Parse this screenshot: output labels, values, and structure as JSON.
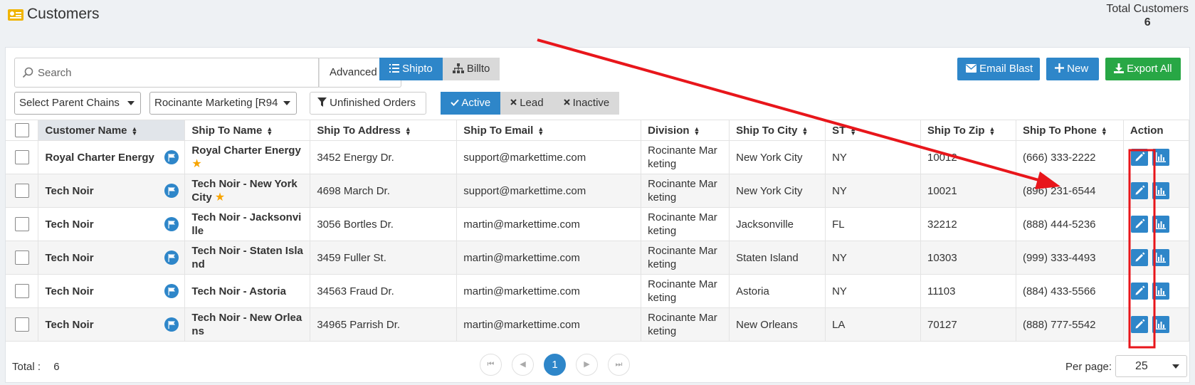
{
  "header": {
    "title": "Customers",
    "icon": "contact-card-icon",
    "total_label": "Total Customers",
    "total_value": "6"
  },
  "toolbar": {
    "search_placeholder": "Search",
    "advanced_label": "Advanced",
    "view_toggle": [
      {
        "label": "Shipto",
        "active": true,
        "icon": "list-icon"
      },
      {
        "label": "Billto",
        "active": false,
        "icon": "sitemap-icon"
      }
    ],
    "email_blast_label": "Email Blast",
    "new_label": "New",
    "export_all_label": "Export All"
  },
  "filters": {
    "parent_chains": "Select Parent Chains",
    "company": "Rocinante Marketing [R94",
    "unfinished_orders": "Unfinished Orders",
    "status": [
      {
        "label": "Active",
        "active": true,
        "icon": "check-icon"
      },
      {
        "label": "Lead",
        "active": false,
        "icon": "x-icon"
      },
      {
        "label": "Inactive",
        "active": false,
        "icon": "x-icon"
      }
    ]
  },
  "table": {
    "columns": [
      "Customer Name",
      "Ship To Name",
      "Ship To Address",
      "Ship To Email",
      "Division",
      "Ship To City",
      "ST",
      "Ship To Zip",
      "Ship To Phone",
      "Action"
    ],
    "rows": [
      {
        "customer": "Royal Charter Energy",
        "shipto_name": "Royal Charter Energy",
        "starred": true,
        "address": "3452 Energy Dr.",
        "email": "support@markettime.com",
        "division": "Rocinante Marketing",
        "city": "New York City",
        "st": "NY",
        "zip": "10012",
        "phone": "(666) 333-2222"
      },
      {
        "customer": "Tech Noir",
        "shipto_name": "Tech Noir - New York City",
        "starred": true,
        "address": "4698 March Dr.",
        "email": "support@markettime.com",
        "division": "Rocinante Marketing",
        "city": "New York City",
        "st": "NY",
        "zip": "10021",
        "phone": "(896) 231-6544"
      },
      {
        "customer": "Tech Noir",
        "shipto_name": "Tech Noir - Jacksonville",
        "starred": false,
        "address": "3056 Bortles Dr.",
        "email": "martin@markettime.com",
        "division": "Rocinante Marketing",
        "city": "Jacksonville",
        "st": "FL",
        "zip": "32212",
        "phone": "(888) 444-5236"
      },
      {
        "customer": "Tech Noir",
        "shipto_name": "Tech Noir - Staten Island",
        "starred": false,
        "address": "3459 Fuller St.",
        "email": "martin@markettime.com",
        "division": "Rocinante Marketing",
        "city": "Staten Island",
        "st": "NY",
        "zip": "10303",
        "phone": "(999) 333-4493"
      },
      {
        "customer": "Tech Noir",
        "shipto_name": "Tech Noir - Astoria",
        "starred": false,
        "address": "34563 Fraud Dr.",
        "email": "martin@markettime.com",
        "division": "Rocinante Marketing",
        "city": "Astoria",
        "st": "NY",
        "zip": "11103",
        "phone": "(884) 433-5566"
      },
      {
        "customer": "Tech Noir",
        "shipto_name": "Tech Noir - New Orleans",
        "starred": false,
        "address": "34965 Parrish Dr.",
        "email": "martin@markettime.com",
        "division": "Rocinante Marketing",
        "city": "New Orleans",
        "st": "LA",
        "zip": "70127",
        "phone": "(888) 777-5542"
      }
    ]
  },
  "footer": {
    "total_label": "Total :",
    "total_value": "6",
    "current_page": "1",
    "per_page_label": "Per page:",
    "per_page_value": "25"
  },
  "colors": {
    "primary": "#2e86c9",
    "success": "#28a745",
    "annotation": "#e8161b",
    "star": "#f7a400",
    "header_icon": "#f0b400"
  }
}
